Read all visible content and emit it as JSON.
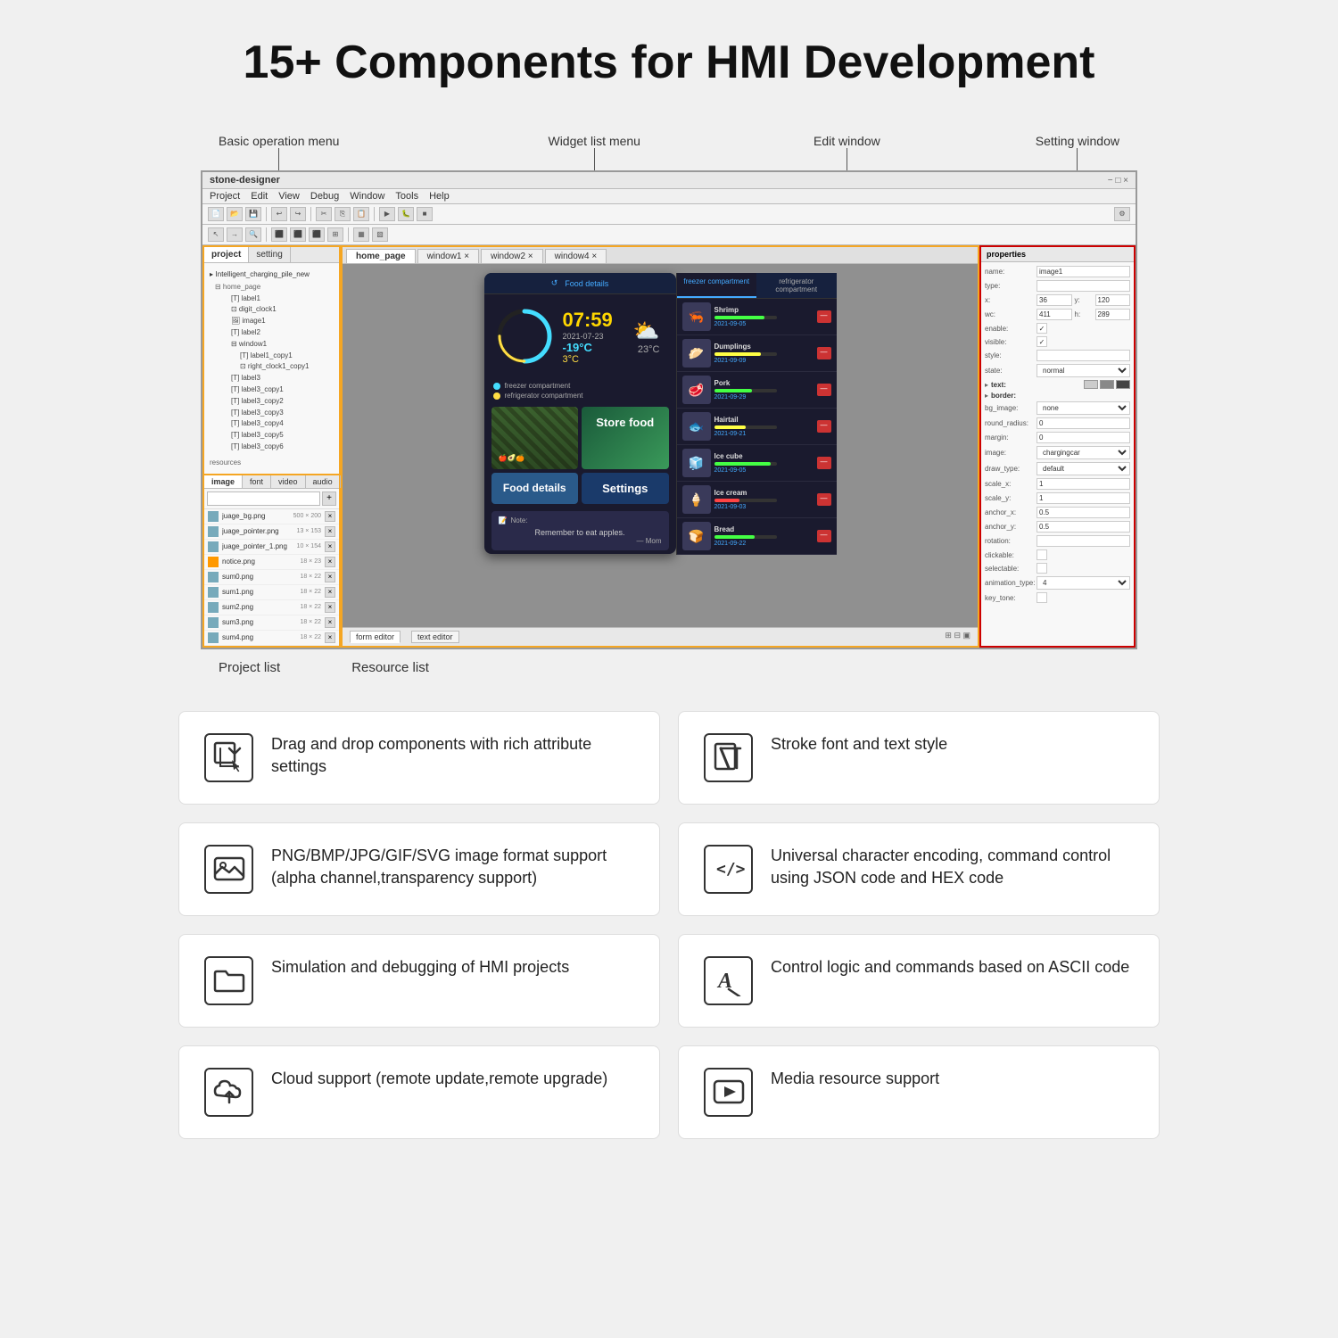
{
  "title": "15+ Components for HMI Development",
  "annotations": {
    "basic_op": "Basic operation menu",
    "widget_list": "Widget list menu",
    "edit_window": "Edit window",
    "setting_window": "Setting window",
    "project_list": "Project list",
    "resource_list": "Resource list"
  },
  "ide": {
    "title": "stone-designer",
    "menu_items": [
      "Project",
      "Edit",
      "View",
      "Debug",
      "Window",
      "Tools",
      "Help"
    ],
    "tabs": [
      "home_page",
      "window1",
      "window2",
      "window4"
    ],
    "active_tab": "home_page",
    "project_label": "project",
    "setting_label": "setting"
  },
  "project_tree": {
    "root": "Intelligent_charging_pile_new",
    "items": [
      "home_page",
      "label1",
      "digit_clock1",
      "image1",
      "label2",
      "window1",
      "label1_copy1",
      "right_clock1_copy1",
      "label3",
      "label3_copy1",
      "label3_copy2",
      "label3_copy3",
      "label3_copy4",
      "label3_copy5",
      "label3_copy6"
    ]
  },
  "resources": {
    "tabs": [
      "image",
      "font",
      "video",
      "audio"
    ],
    "items": [
      {
        "name": "juage_bg.png",
        "size": "500 × 200",
        "type": "image"
      },
      {
        "name": "juage_pointer.png",
        "size": "13 × 153",
        "type": "image"
      },
      {
        "name": "juage_pointer_1.png",
        "size": "10 × 154",
        "type": "image"
      },
      {
        "name": "notice.png",
        "size": "18 × 23",
        "type": "warning"
      },
      {
        "name": "sum0.png",
        "size": "18 × 22",
        "type": "image"
      },
      {
        "name": "sum1.png",
        "size": "18 × 22",
        "type": "image"
      },
      {
        "name": "sum2.png",
        "size": "18 × 22",
        "type": "image"
      },
      {
        "name": "sum3.png",
        "size": "18 × 22",
        "type": "image"
      },
      {
        "name": "sum4.png",
        "size": "18 × 22",
        "type": "image"
      }
    ]
  },
  "phone": {
    "header": "Food details",
    "back_icon": "←",
    "time": "07:59",
    "date": "2021-07-23",
    "temp_cold": "-19°C",
    "temp_warm": "3°C",
    "weather_temp": "23°C",
    "legend_cold": "freezer compartment",
    "legend_warm": "refrigerator compartment",
    "nav_buttons": {
      "store_food": "Store food",
      "food_details": "Food details",
      "settings": "Settings"
    },
    "note_label": "Note:",
    "note_text": "Remember to eat apples.",
    "note_sig": "— Mom",
    "food_tabs": [
      "freezer compartment",
      "refrigerator compartment"
    ],
    "food_items": [
      {
        "name": "Shrimp",
        "date": "2021-09-05",
        "bar": 80,
        "emoji": "🦐"
      },
      {
        "name": "Dumplings",
        "date": "2021-09-09",
        "bar": 75,
        "emoji": "🥟"
      },
      {
        "name": "Pork",
        "date": "2021-09-29",
        "bar": 60,
        "emoji": "🥩"
      },
      {
        "name": "Hairtail",
        "date": "2021-09-21",
        "bar": 50,
        "emoji": "🐟"
      },
      {
        "name": "Ice cube",
        "date": "2021-09-05",
        "bar": 90,
        "emoji": "🧊"
      },
      {
        "name": "Ice cream",
        "date": "2021-09-03",
        "bar": 40,
        "emoji": "🍦"
      },
      {
        "name": "Bread",
        "date": "2021-09-22",
        "bar": 65,
        "emoji": "🍞"
      }
    ]
  },
  "properties": {
    "title": "properties",
    "fields": {
      "name": "image1",
      "type": "",
      "x": "36",
      "y": "120",
      "w": "411",
      "h": "289",
      "enable": true,
      "visible": true,
      "style": "",
      "state": "normal",
      "image": "chargingcar",
      "draw_type": "default",
      "scale_x": "1",
      "scale_y": "1",
      "anchor_x": "0.5",
      "anchor_y": "0.5",
      "rotation": "",
      "clickable": false,
      "selectable": false,
      "animation_type": "4",
      "key_tone": false
    }
  },
  "bottom_tabs": [
    "form editor",
    "text editor"
  ],
  "features": [
    {
      "icon": "drag-drop-icon",
      "desc": "Drag and drop components with rich attribute settings",
      "icon_type": "cursor"
    },
    {
      "icon": "stroke-font-icon",
      "desc": "Stroke font and text style",
      "icon_type": "text_stroke"
    },
    {
      "icon": "image-format-icon",
      "desc": "PNG/BMP/JPG/GIF/SVG image format support (alpha channel,transparency support)",
      "icon_type": "image"
    },
    {
      "icon": "unicode-icon",
      "desc": "Universal character encoding, command control using JSON code and HEX code",
      "icon_type": "code"
    },
    {
      "icon": "simulation-icon",
      "desc": "Simulation and debugging of HMI projects",
      "icon_type": "folder"
    },
    {
      "icon": "ascii-icon",
      "desc": "Control logic and commands based on ASCII code",
      "icon_type": "ascii"
    },
    {
      "icon": "cloud-icon",
      "desc": "Cloud support (remote update,remote upgrade)",
      "icon_type": "cloud"
    },
    {
      "icon": "media-icon",
      "desc": "Media resource support",
      "icon_type": "media"
    }
  ]
}
